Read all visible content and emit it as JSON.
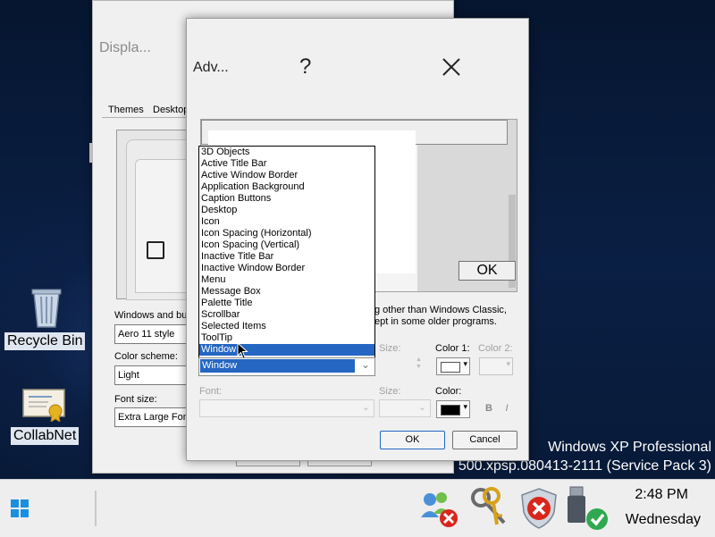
{
  "desktop": {
    "icons": [
      {
        "label": "Recycle Bin",
        "icon": "recycle-bin-icon"
      },
      {
        "label": "CollabNet",
        "icon": "certificate-icon"
      }
    ],
    "watermark": {
      "line1": "Windows XP Professional",
      "line2": "500.xpsp.080413-2111 (Service Pack 3)"
    }
  },
  "display_window": {
    "title": "Displa...",
    "tabs": [
      "Themes",
      "Desktop"
    ],
    "windows_buttons_label": "Windows and but",
    "windows_buttons_value": "Aero 11 style",
    "color_scheme_label": "Color scheme:",
    "color_scheme_value": "Light",
    "font_size_label": "Font size:",
    "font_size_value": "Extra Large Font"
  },
  "advanced_dialog": {
    "title": "Adv...",
    "help_glyph": "?",
    "preview_ok_label": "OK",
    "info_line1": "g other than Windows Classic,",
    "info_line2": "ept in some older programs.",
    "size_label": "Size:",
    "color1_label": "Color 1:",
    "color2_label": "Color 2:",
    "font_label": "Font:",
    "font_size_label": "Size:",
    "font_color_label": "Color:",
    "bold_label": "B",
    "italic_label": "I",
    "ok_label": "OK",
    "cancel_label": "Cancel",
    "item_combo_value": "Window",
    "item_options": [
      "3D Objects",
      "Active Title Bar",
      "Active Window Border",
      "Application Background",
      "Caption Buttons",
      "Desktop",
      "Icon",
      "Icon Spacing (Horizontal)",
      "Icon Spacing (Vertical)",
      "Inactive Title Bar",
      "Inactive Window Border",
      "Menu",
      "Message Box",
      "Palette Title",
      "Scrollbar",
      "Selected Items",
      "ToolTip",
      "Window"
    ],
    "selected_option": "Window",
    "colors": {
      "selection": "#2466c2",
      "color1": "#ffffff",
      "font_color": "#000000"
    }
  },
  "taskbar": {
    "time": "2:48 PM",
    "day": "Wednesday",
    "tray_icons": [
      "network-error-icon",
      "keys-icon",
      "security-alert-icon",
      "usb-device-icon"
    ]
  }
}
